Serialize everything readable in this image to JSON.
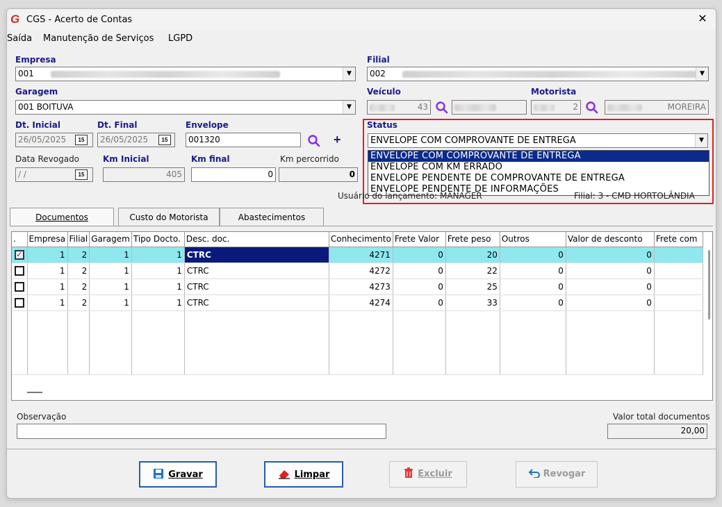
{
  "window": {
    "title": "CGS - Acerto de Contas",
    "close": "✕"
  },
  "menu": [
    "Saída",
    "Manutenção de Serviços",
    "LGPD"
  ],
  "form": {
    "empresa_label": "Empresa",
    "empresa_value": "001",
    "filial_label": "Filial",
    "filial_value": "002",
    "garagem_label": "Garagem",
    "garagem_value": "001 BOITUVA",
    "veiculo_label": "Veículo",
    "veiculo_value": "43",
    "motorista_label": "Motorista",
    "motorista_code": "2",
    "motorista_name": "MOREIRA",
    "dt_inicial_label": "Dt. Inicial",
    "dt_inicial_value": "26/05/2025",
    "dt_final_label": "Dt. Final",
    "dt_final_value": "26/05/2025",
    "envelope_label": "Envelope",
    "envelope_value": "001320",
    "status_label": "Status",
    "status_value": "ENVELOPE COM COMPROVANTE DE ENTREGA",
    "status_options": [
      "ENVELOPE COM COMPROVANTE DE ENTREGA",
      "ENVELOPE COM KM ERRADO",
      "ENVELOPE PENDENTE DE COMPROVANTE DE ENTREGA",
      "ENVELOPE PENDENTE DE INFORMAÇÕES"
    ],
    "data_revogado_label": "Data Revogado",
    "data_revogado_value": " / /",
    "km_inicial_label": "Km Inicial",
    "km_inicial_value": "405",
    "km_final_label": "Km final",
    "km_final_value": "0",
    "km_percorrido_label": "Km percorrido",
    "km_percorrido_value": "0",
    "usuario_text": "Usuário do lançamento: MANAGER",
    "filial_text": "Filial: 3 - CMD HORTOLÂNDIA"
  },
  "tabs": [
    "Documentos",
    "Custo do Motorista",
    "Abastecimentos"
  ],
  "grid": {
    "headers": [
      ".",
      "Empresa",
      "Filial",
      "Garagem",
      "Tipo Docto.",
      "Desc. doc.",
      "Conhecimento",
      "Frete Valor",
      "Frete peso",
      "Outros",
      "Valor de desconto",
      "Frete com"
    ],
    "rows": [
      {
        "checked": true,
        "empresa": "1",
        "filial": "2",
        "garagem": "1",
        "tipo": "1",
        "desc": "CTRC",
        "conhecimento": "4271",
        "frete_valor": "0",
        "frete_peso": "20",
        "outros": "0",
        "desconto": "0"
      },
      {
        "checked": false,
        "empresa": "1",
        "filial": "2",
        "garagem": "1",
        "tipo": "1",
        "desc": "CTRC",
        "conhecimento": "4272",
        "frete_valor": "0",
        "frete_peso": "22",
        "outros": "0",
        "desconto": "0"
      },
      {
        "checked": false,
        "empresa": "1",
        "filial": "2",
        "garagem": "1",
        "tipo": "1",
        "desc": "CTRC",
        "conhecimento": "4273",
        "frete_valor": "0",
        "frete_peso": "25",
        "outros": "0",
        "desconto": "0"
      },
      {
        "checked": false,
        "empresa": "1",
        "filial": "2",
        "garagem": "1",
        "tipo": "1",
        "desc": "CTRC",
        "conhecimento": "4274",
        "frete_valor": "0",
        "frete_peso": "33",
        "outros": "0",
        "desconto": "0"
      }
    ]
  },
  "footer": {
    "observacao_label": "Observação",
    "observacao_value": "",
    "valor_total_label": "Valor total documentos",
    "valor_total_value": "20,00"
  },
  "buttons": {
    "gravar": "Gravar",
    "limpar": "Limpar",
    "excluir": "Excluir",
    "revogar": "Revogar"
  },
  "colors": {
    "accent": "#1a1a8c",
    "selection": "#0a2a8c",
    "highlight_row": "#8ee8ee",
    "status_border": "#e02020"
  }
}
